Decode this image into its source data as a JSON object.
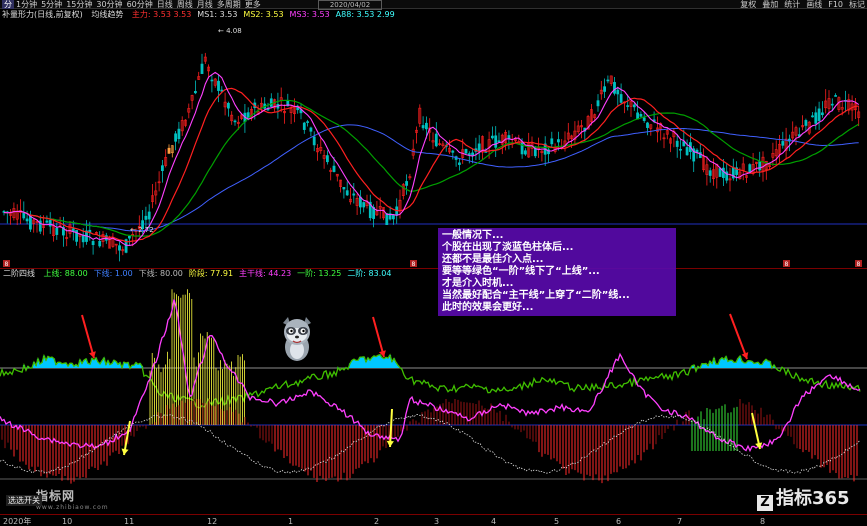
{
  "toolbar": {
    "periods": [
      "分",
      "1分钟",
      "5分钟",
      "15分钟",
      "30分钟",
      "60分钟",
      "日线",
      "周线",
      "月线",
      "多周期",
      "更多"
    ],
    "active_index": 0,
    "date": "2020/04/02",
    "right_buttons": [
      "复权",
      "叠加",
      "统计",
      "画线",
      "F10",
      "标记"
    ]
  },
  "main_header": {
    "title": "补量形力(日线,前复权)",
    "tag": "均线趋势",
    "items": [
      {
        "text": "主力: 3.53  3.53",
        "color": "#ff3030"
      },
      {
        "text": "MS1: 3.53",
        "color": "#dddddd"
      },
      {
        "text": "MS2: 3.53",
        "color": "#ffff40"
      },
      {
        "text": "MS3: 3.53",
        "color": "#ff40ff"
      },
      {
        "text": "A88: 3.53  2.99",
        "color": "#40ffff"
      }
    ],
    "high_label": "4.08",
    "low_label": "2.72"
  },
  "indicator_header": {
    "name": "二阶四线",
    "items": [
      {
        "text": "上线: 88.00",
        "color": "#40ff40"
      },
      {
        "text": "下线: 1.00",
        "color": "#4080ff"
      },
      {
        "text": "下线: 80.00",
        "color": "#bbbbbb"
      },
      {
        "text": "阶段: 77.91",
        "color": "#ffff40"
      },
      {
        "text": "主干线: 44.23",
        "color": "#ff40ff"
      },
      {
        "text": "一阶: 13.25",
        "color": "#40ff40"
      },
      {
        "text": "二阶: 83.04",
        "color": "#40ffff"
      }
    ]
  },
  "annotation": {
    "lines": [
      "一般情况下...",
      "个股在出现了淡蓝色柱体后...",
      "还都不是最佳介入点...",
      "要等等绿色“一阶”线下了“上线”...",
      "才是介入时机...",
      "当然最好配合“主干线”上穿了“二阶”线...",
      "此时的效果会更好..."
    ]
  },
  "axis_labels": [
    "2020年",
    "10",
    "11",
    "12",
    "1",
    "2",
    "3",
    "4",
    "5",
    "6",
    "7",
    "8"
  ],
  "bottom_tab": "选选开关",
  "watermarks": {
    "left": "指标网",
    "left_url": "www.zhibiaow.com",
    "right": "指标365"
  },
  "side_marks": [
    "8",
    "8",
    "8",
    "8"
  ],
  "colors": {
    "up": "#ff2020",
    "down": "#00c0c0",
    "ma_short": "#ff40ff",
    "ma_mid": "#ff2020",
    "ma_long": "#00a000",
    "ma_slow": "#4060ff",
    "blue_hist": "#00c8ff",
    "green_line": "#40c000",
    "magenta_line": "#ff40ff",
    "arrow_red": "#ff2020",
    "arrow_yellow": "#ffff40"
  }
}
